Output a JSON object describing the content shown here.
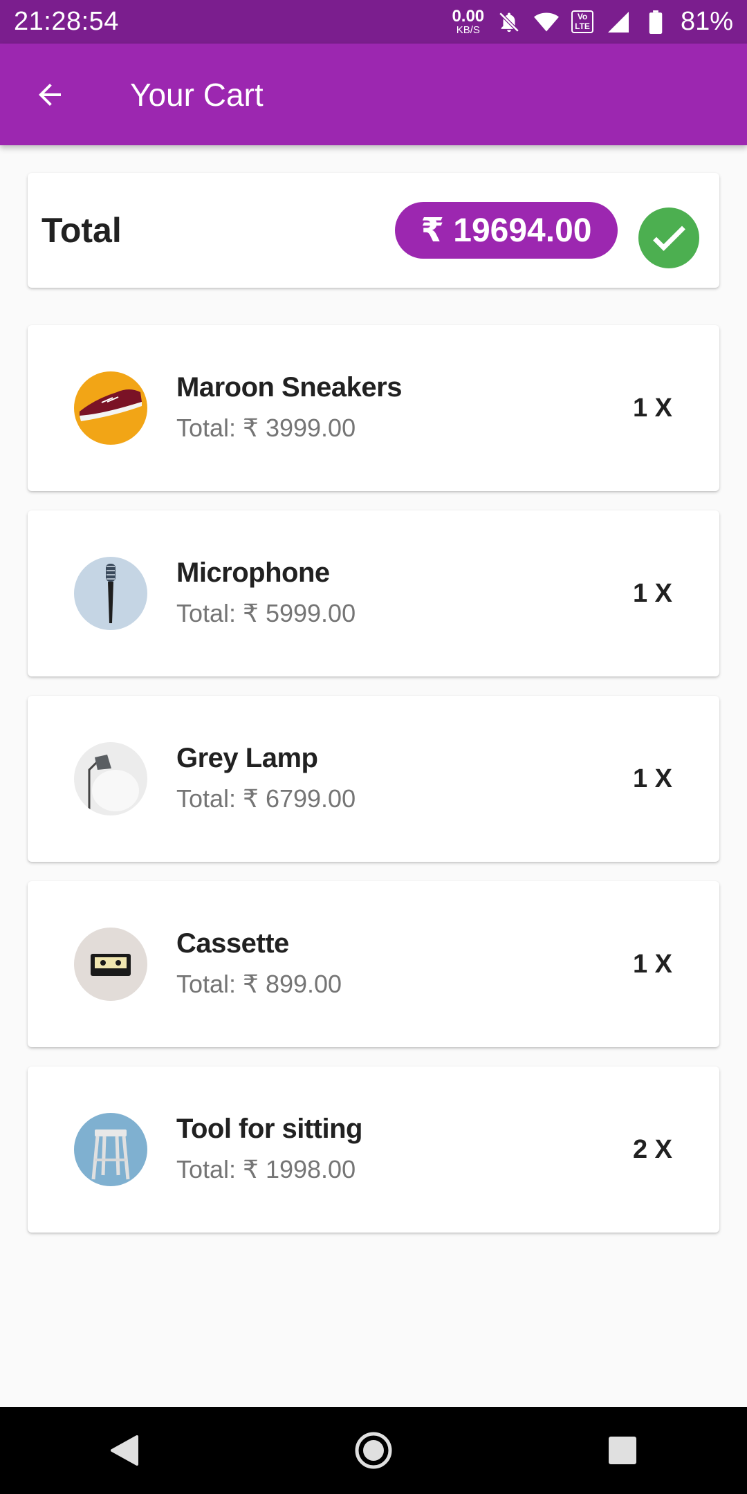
{
  "status_bar": {
    "time": "21:28:54",
    "net_speed_value": "0.00",
    "net_speed_unit": "KB/S",
    "lte_label_top": "Vo",
    "lte_label_bottom": "LTE",
    "battery": "81%"
  },
  "app_bar": {
    "title": "Your Cart"
  },
  "total": {
    "label": "Total",
    "amount": "₹ 19694.00"
  },
  "items": [
    {
      "name": "Maroon Sneakers",
      "total": "Total: ₹ 3999.00",
      "qty": "1 X"
    },
    {
      "name": "Microphone",
      "total": "Total: ₹ 5999.00",
      "qty": "1 X"
    },
    {
      "name": "Grey Lamp",
      "total": "Total: ₹ 6799.00",
      "qty": "1 X"
    },
    {
      "name": "Cassette",
      "total": "Total: ₹ 899.00",
      "qty": "1 X"
    },
    {
      "name": "Tool for sitting",
      "total": "Total: ₹ 1998.00",
      "qty": "2 X"
    }
  ],
  "colors": {
    "status_bar": "#7b1e8e",
    "app_bar": "#9c27b0",
    "accent": "#9c27b0",
    "confirm": "#4caf50"
  },
  "icons": {
    "back": "arrow-left-icon",
    "confirm": "check-icon",
    "nav_back": "triangle-back-icon",
    "nav_home": "circle-home-icon",
    "nav_recents": "square-recents-icon"
  }
}
